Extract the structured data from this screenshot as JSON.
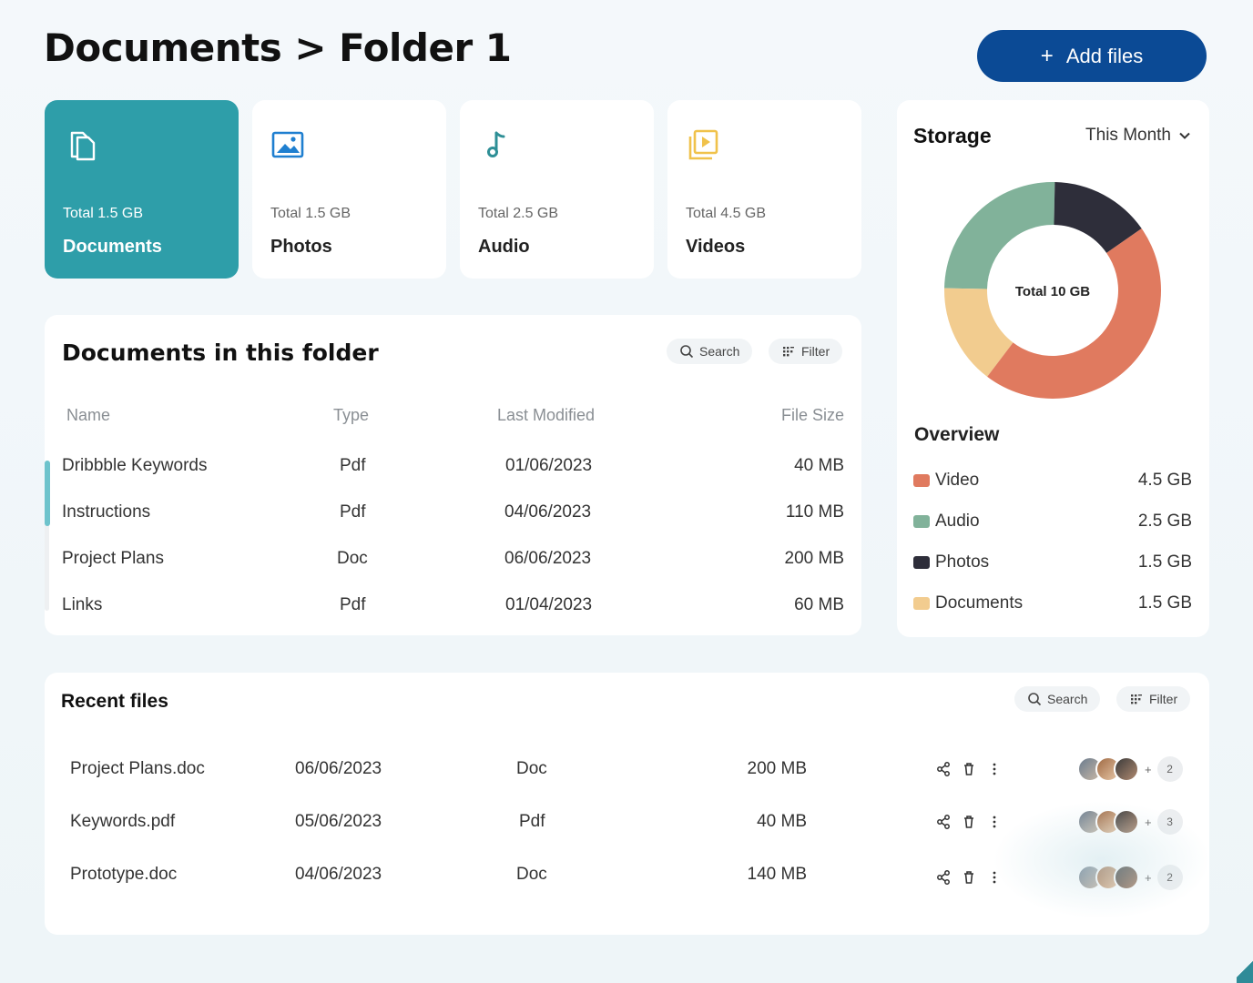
{
  "header": {
    "title": "Documents > Folder 1",
    "add_files_label": "Add files",
    "add_icon": "plus-icon"
  },
  "categories": [
    {
      "name": "Documents",
      "total": "Total 1.5 GB",
      "icon": "documents-icon",
      "active": true,
      "color": "#2e9ea9"
    },
    {
      "name": "Photos",
      "total": "Total 1.5 GB",
      "icon": "image-icon",
      "color": "#1f7fd0"
    },
    {
      "name": "Audio",
      "total": "Total 2.5 GB",
      "icon": "music-note-icon",
      "color": "#2e8f96"
    },
    {
      "name": "Videos",
      "total": "Total 4.5 GB",
      "icon": "video-play-icon",
      "color": "#f0c24b"
    }
  ],
  "folder_docs": {
    "title": "Documents in this folder",
    "search_label": "Search",
    "filter_label": "Filter",
    "columns": [
      "Name",
      "Type",
      "Last Modified",
      "File Size"
    ],
    "rows": [
      [
        "Dribbble Keywords",
        "Pdf",
        "01/06/2023",
        "40 MB"
      ],
      [
        "Instructions",
        "Pdf",
        "04/06/2023",
        "110 MB"
      ],
      [
        "Project Plans",
        "Doc",
        "06/06/2023",
        "200 MB"
      ],
      [
        "Links",
        "Pdf",
        "01/04/2023",
        "60 MB"
      ]
    ]
  },
  "storage": {
    "title": "Storage",
    "period": "This Month",
    "donut_center": "Total 10 GB",
    "overview_title": "Overview",
    "items": [
      {
        "label": "Video",
        "value": "4.5 GB",
        "gb": 4.5,
        "color": "#e07a5f"
      },
      {
        "label": "Audio",
        "value": "2.5 GB",
        "gb": 2.5,
        "color": "#81b29a"
      },
      {
        "label": "Photos",
        "value": "1.5 GB",
        "gb": 1.5,
        "color": "#2e2e3a"
      },
      {
        "label": "Documents",
        "value": "1.5 GB",
        "gb": 1.5,
        "color": "#f2cc8f"
      }
    ]
  },
  "recent": {
    "title": "Recent files",
    "search_label": "Search",
    "filter_label": "Filter",
    "rows": [
      {
        "name": "Project Plans.doc",
        "date": "06/06/2023",
        "type": "Doc",
        "size": "200 MB",
        "extra": "2"
      },
      {
        "name": "Keywords.pdf",
        "date": "05/06/2023",
        "type": "Pdf",
        "size": "40 MB",
        "extra": "3"
      },
      {
        "name": "Prototype.doc",
        "date": "04/06/2023",
        "type": "Doc",
        "size": "140 MB",
        "extra": "2"
      }
    ],
    "plus_sign": "+"
  }
}
